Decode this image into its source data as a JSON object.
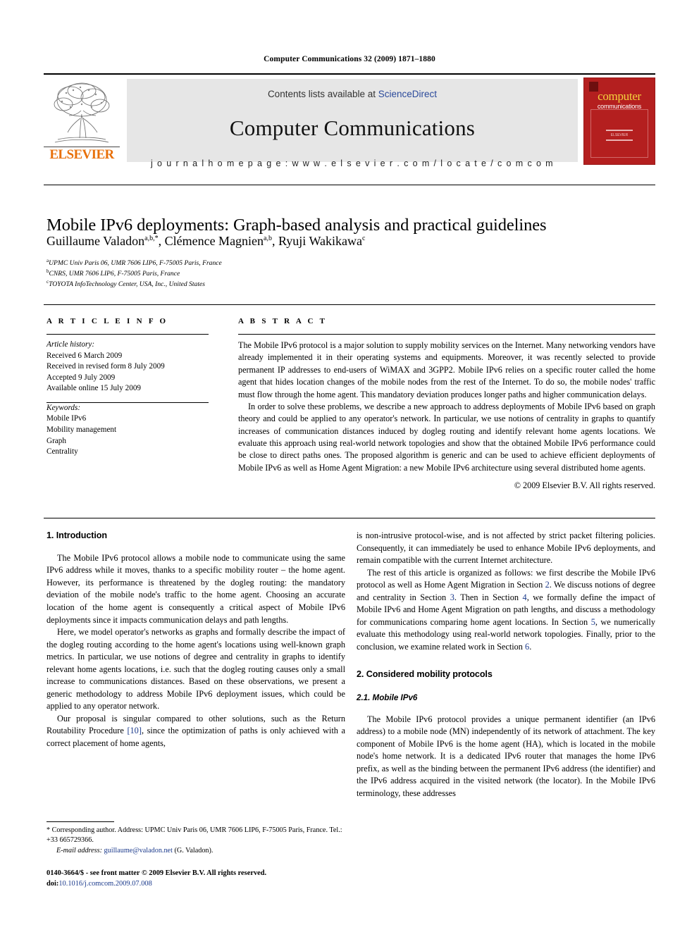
{
  "running_head": "Computer Communications 32 (2009) 1871–1880",
  "masthead": {
    "publisher_name": "ELSEVIER",
    "contents_prefix": "Contents lists available at ",
    "contents_link": "ScienceDirect",
    "journal_title": "Computer Communications",
    "homepage": "j o u r n a l   h o m e p a g e :   w w w . e l s e v i e r . c o m / l o c a t e / c o m c o m",
    "cover": {
      "word1": "computer",
      "word2": "communications",
      "badge_text": "ELSEVIER"
    }
  },
  "article": {
    "title": "Mobile IPv6 deployments: Graph-based analysis and practical guidelines",
    "authors": "Guillaume Valadon",
    "authors_sup_1": "a,b,*",
    "authors_2": ", Clémence Magnien",
    "authors_sup_2": "a,b",
    "authors_3": ", Ryuji Wakikawa",
    "authors_sup_3": "c",
    "affiliations": [
      {
        "mark": "a",
        "text": "UPMC Univ Paris 06, UMR 7606 LIP6, F-75005 Paris, France"
      },
      {
        "mark": "b",
        "text": "CNRS, UMR 7606 LIP6, F-75005 Paris, France"
      },
      {
        "mark": "c",
        "text": "TOYOTA InfoTechnology Center, USA, Inc., United States"
      }
    ]
  },
  "info": {
    "heading": "A R T I C L E  I N F O",
    "history_label": "Article history:",
    "history": [
      "Received 6 March 2009",
      "Received in revised form 8 July 2009",
      "Accepted 9 July 2009",
      "Available online 15 July 2009"
    ],
    "keywords_label": "Keywords:",
    "keywords": [
      "Mobile IPv6",
      "Mobility management",
      "Graph",
      "Centrality"
    ]
  },
  "abstract": {
    "heading": "A B S T R A C T",
    "paragraphs": [
      "The Mobile IPv6 protocol is a major solution to supply mobility services on the Internet. Many networking vendors have already implemented it in their operating systems and equipments. Moreover, it was recently selected to provide permanent IP addresses to end-users of WiMAX and 3GPP2. Mobile IPv6 relies on a specific router called the home agent that hides location changes of the mobile nodes from the rest of the Internet. To do so, the mobile nodes' traffic must flow through the home agent. This mandatory deviation produces longer paths and higher communication delays.",
      "In order to solve these problems, we describe a new approach to address deployments of Mobile IPv6 based on graph theory and could be applied to any operator's network. In particular, we use notions of centrality in graphs to quantify increases of communication distances induced by dogleg routing and identify relevant home agents locations. We evaluate this approach using real-world network topologies and show that the obtained Mobile IPv6 performance could be close to direct paths ones. The proposed algorithm is generic and can be used to achieve efficient deployments of Mobile IPv6 as well as Home Agent Migration: a new Mobile IPv6 architecture using several distributed home agents."
    ],
    "copyright": "© 2009 Elsevier B.V. All rights reserved."
  },
  "body": {
    "left": {
      "section1_heading": "1. Introduction",
      "p1": "The Mobile IPv6 protocol allows a mobile node to communicate using the same IPv6 address while it moves, thanks to a specific mobility router – the home agent. However, its performance is threatened by the dogleg routing: the mandatory deviation of the mobile node's traffic to the home agent. Choosing an accurate location of the home agent is consequently a critical aspect of Mobile IPv6 deployments since it impacts communication delays and path lengths.",
      "p2": "Here, we model operator's networks as graphs and formally describe the impact of the dogleg routing according to the home agent's locations using well-known graph metrics. In particular, we use notions of degree and centrality in graphs to identify relevant home agents locations, i.e. such that the dogleg routing causes only a small increase to communications distances. Based on these observations, we present a generic methodology to address Mobile IPv6 deployment issues, which could be applied to any operator network.",
      "p3_a": "Our proposal is singular compared to other solutions, such as the Return Routability Procedure ",
      "p3_ref": "[10]",
      "p3_b": ", since the optimization of paths is only achieved with a correct placement of home agents,"
    },
    "right": {
      "p1_cont": "is non-intrusive protocol-wise, and is not affected by strict packet filtering policies. Consequently, it can immediately be used to enhance Mobile IPv6 deployments, and remain compatible with the current Internet architecture.",
      "p2_a": "The rest of this article is organized as follows: we first describe the Mobile IPv6 protocol as well as Home Agent Migration in Section ",
      "p2_r1": "2",
      "p2_b": ". We discuss notions of degree and centrality in Section ",
      "p2_r2": "3",
      "p2_c": ". Then in Section ",
      "p2_r3": "4",
      "p2_d": ", we formally define the impact of Mobile IPv6 and Home Agent Migration on path lengths, and discuss a methodology for communications comparing home agent locations. In Section ",
      "p2_r4": "5",
      "p2_e": ", we numerically evaluate this methodology using real-world network topologies. Finally, prior to the conclusion, we examine related work in Section ",
      "p2_r5": "6",
      "p2_f": ".",
      "section2_heading": "2. Considered mobility protocols",
      "subsection21_heading": "2.1. Mobile IPv6",
      "p3": "The Mobile IPv6 protocol provides a unique permanent identifier (an IPv6 address) to a mobile node (MN) independently of its network of attachment. The key component of Mobile IPv6 is the home agent (HA), which is located in the mobile node's home network. It is a dedicated IPv6 router that manages the home IPv6 prefix, as well as the binding between the permanent IPv6 address (the identifier) and the IPv6 address acquired in the visited network (the locator). In the Mobile IPv6 terminology, these addresses"
    }
  },
  "footnote": {
    "star": "*",
    "corresponding": " Corresponding author. Address: UPMC Univ Paris 06, UMR 7606 LIP6, F-75005 Paris, France. Tel.: +33 665729366.",
    "email_label": "E-mail address:",
    "email": "guillaume@valadon.net",
    "email_suffix": " (G. Valadon)."
  },
  "footer": {
    "issn_line": "0140-3664/$ - see front matter © 2009 Elsevier B.V. All rights reserved.",
    "doi_label": "doi:",
    "doi": "10.1016/j.comcom.2009.07.008"
  },
  "colors": {
    "link": "#1b3a8c",
    "sciencedirect": "#2b4a9b",
    "elsevier_orange": "#e8700a",
    "cover_red": "#b41f1f",
    "cover_yellow": "#f4d23c",
    "masthead_grey": "#e6e6e6"
  }
}
